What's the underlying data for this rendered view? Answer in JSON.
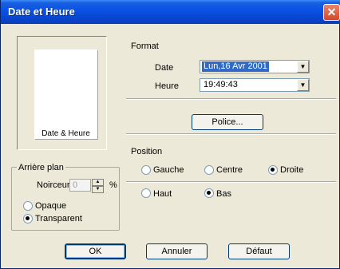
{
  "window": {
    "title": "Date et Heure",
    "close_glyph": "✕"
  },
  "preview": {
    "label": "Date & Heure"
  },
  "format": {
    "title": "Format",
    "date_label": "Date",
    "date_value": "Lun,16 Avr 2001",
    "heure_label": "Heure",
    "heure_value": "19:49:43",
    "police_button": "Police..."
  },
  "position": {
    "title": "Position",
    "gauche": "Gauche",
    "centre": "Centre",
    "droite": "Droite",
    "haut": "Haut",
    "bas": "Bas",
    "horizontal_selected": "droite",
    "vertical_selected": "bas"
  },
  "arriere_plan": {
    "title": "Arrière plan",
    "noirceur_label": "Noirceur",
    "noirceur_value": "0",
    "percent": "%",
    "opaque": "Opaque",
    "transparent": "Transparent",
    "selected": "transparent"
  },
  "buttons": {
    "ok": "OK",
    "annuler": "Annuler",
    "defaut": "Défaut"
  },
  "colors": {
    "titlebar": "#0a54e6",
    "close": "#d2482a",
    "selection": "#316ac5",
    "dialog_bg": "#ece9d8"
  },
  "icons": {
    "close": "close-icon",
    "dropdown": "chevron-down-icon",
    "spin_up": "spin-up-icon",
    "spin_down": "spin-down-icon"
  }
}
